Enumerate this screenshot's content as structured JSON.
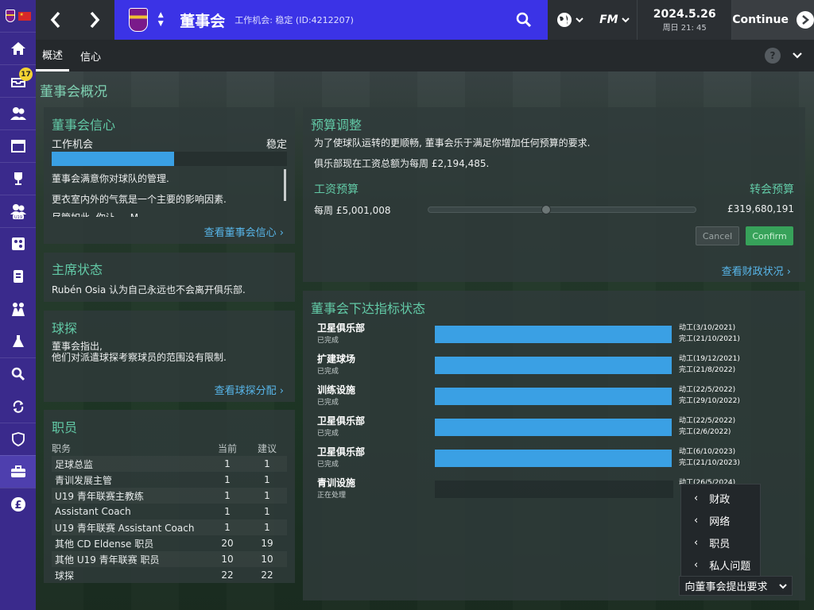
{
  "topbar": {
    "page_title": "董事会",
    "page_subtitle": "工作机会: 稳定 (ID:4212207)",
    "fm_label": "FM",
    "date": "2024.5.26",
    "day_time": "周日 21: 45",
    "continue_label": "Continue"
  },
  "sidebar": {
    "inbox_badge": "17"
  },
  "tabs": [
    {
      "label": "概述"
    },
    {
      "label": "信心"
    }
  ],
  "help_label": "?",
  "section_title": "董事会概况",
  "board_confidence": {
    "title": "董事会信心",
    "job_security_label": "工作机会",
    "job_security_value": "稳定",
    "confidence_fraction": 0.52,
    "lines": [
      "董事会满意你对球队的管理.",
      "更衣室内外的气氛是一个主要的影响因素.",
      "尽管如此, 你让 ... M..."
    ],
    "link": "查看董事会信心"
  },
  "chairman": {
    "title": "主席状态",
    "text": "Rubén Osia 认为自己永远也不会离开俱乐部."
  },
  "scouting": {
    "title": "球探",
    "line1": "董事会指出,",
    "line2": "他们对派遣球探考察球员的范围没有限制.",
    "link": "查看球探分配"
  },
  "staff": {
    "title": "职员",
    "headers": {
      "role": "职务",
      "current": "当前",
      "recommended": "建议"
    },
    "rows": [
      {
        "role": "足球总监",
        "current": "1",
        "recommended": "1"
      },
      {
        "role": "青训发展主管",
        "current": "1",
        "recommended": "1"
      },
      {
        "role": "U19 青年联赛主教练",
        "current": "1",
        "recommended": "1"
      },
      {
        "role": "Assistant Coach",
        "current": "1",
        "recommended": "1"
      },
      {
        "role": "U19 青年联赛 Assistant Coach",
        "current": "1",
        "recommended": "1"
      },
      {
        "role": "其他 CD Eldense 职员",
        "current": "20",
        "recommended": "19"
      },
      {
        "role": "其他 U19 青年联赛 职员",
        "current": "10",
        "recommended": "10"
      },
      {
        "role": "球探",
        "current": "22",
        "recommended": "22"
      }
    ]
  },
  "budget": {
    "title": "预算调整",
    "line1": "为了使球队运转的更顺畅, 董事会乐于满足你增加任何预算的要求.",
    "line2": "俱乐部现在工资总额为每周 £2,194,485.",
    "wage_label": "工资预算",
    "transfer_label": "转会预算",
    "wage_value": "每周 £5,001,008",
    "transfer_value": "£319,680,191",
    "slider_fraction": 0.44,
    "cancel_label": "Cancel",
    "confirm_label": "Confirm",
    "link": "查看财政状况"
  },
  "kpi": {
    "title": "董事会下达指标状态",
    "items": [
      {
        "name": "卫星俱乐部",
        "status": "已完成",
        "fill": 1.0,
        "start": "动工(3/10/2021)",
        "end": "完工(21/10/2021)"
      },
      {
        "name": "扩建球场",
        "status": "已完成",
        "fill": 1.0,
        "start": "动工(19/12/2021)",
        "end": "完工(21/8/2022)"
      },
      {
        "name": "训练设施",
        "status": "已完成",
        "fill": 1.0,
        "start": "动工(22/5/2022)",
        "end": "完工(29/10/2022)"
      },
      {
        "name": "卫星俱乐部",
        "status": "已完成",
        "fill": 1.0,
        "start": "动工(22/5/2022)",
        "end": "完工(2/6/2022)"
      },
      {
        "name": "卫星俱乐部",
        "status": "已完成",
        "fill": 1.0,
        "start": "动工(6/10/2023)",
        "end": "完工(21/10/2023)"
      },
      {
        "name": "青训设施",
        "status": "正在处理",
        "fill": 0.0,
        "start": "动工(26/5/2024)",
        "end": ""
      }
    ]
  },
  "request_menu": {
    "items": [
      "财政",
      "网络",
      "职员",
      "私人问题"
    ],
    "button_label": "向董事会提出要求"
  },
  "colors": {
    "accent_purple": "#3b33e6",
    "sidebar": "#3a2a8c",
    "bar_blue": "#3aa0e4",
    "heading_green": "#62c9a6",
    "link_blue": "#58b6ea",
    "confirm_green": "#37a25a"
  }
}
